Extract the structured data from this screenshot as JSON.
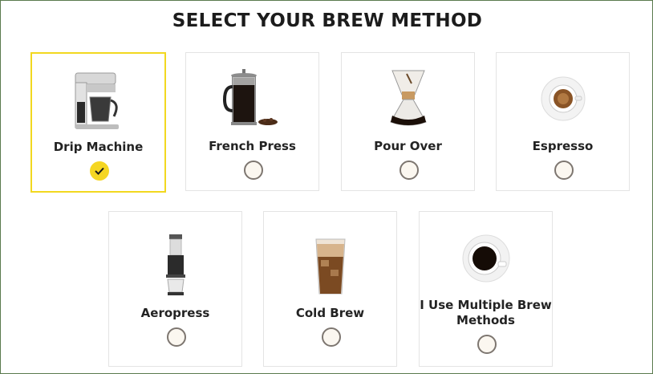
{
  "title": "SELECT YOUR BREW METHOD",
  "accent_color": "#f5d623",
  "methods": [
    {
      "label": "Drip Machine",
      "icon": "drip-machine-icon",
      "selected": true
    },
    {
      "label": "French Press",
      "icon": "french-press-icon",
      "selected": false
    },
    {
      "label": "Pour Over",
      "icon": "pour-over-icon",
      "selected": false
    },
    {
      "label": "Espresso",
      "icon": "espresso-cup-icon",
      "selected": false
    },
    {
      "label": "Aeropress",
      "icon": "aeropress-icon",
      "selected": false
    },
    {
      "label": "Cold Brew",
      "icon": "cold-brew-glass-icon",
      "selected": false
    },
    {
      "label": "I Use Multiple Brew Methods",
      "icon": "coffee-cup-top-view-icon",
      "selected": false
    }
  ]
}
